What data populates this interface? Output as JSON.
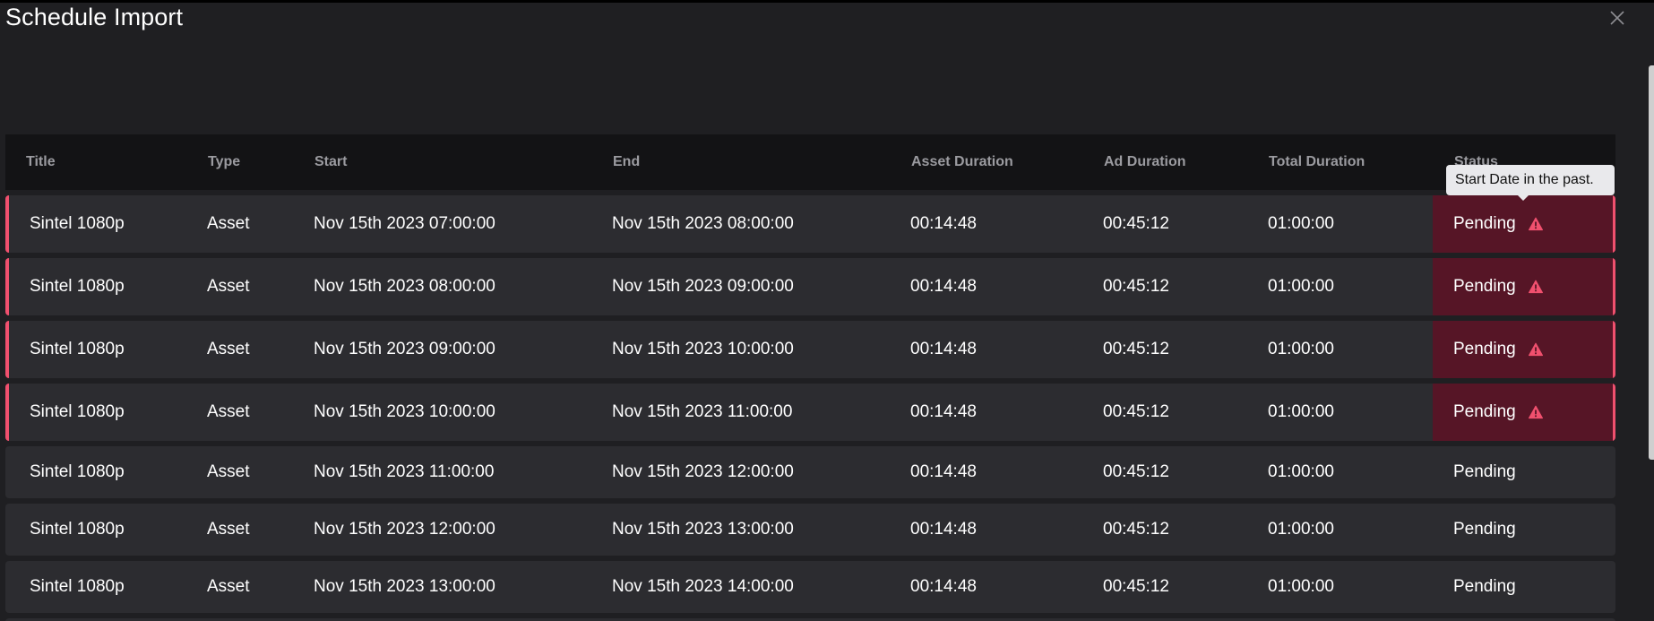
{
  "dialog": {
    "title": "Schedule Import"
  },
  "icons": {
    "close": "close-icon",
    "warning": "warning-triangle-icon"
  },
  "colors": {
    "background": "#1f1f22",
    "header_bg": "#131315",
    "row_bg": "#2c2c30",
    "warning_accent": "#f0506e",
    "warning_status_bg": "#561526",
    "tooltip_bg": "#e9e9ec"
  },
  "table": {
    "columns": [
      "Title",
      "Type",
      "Start",
      "End",
      "Asset Duration",
      "Ad Duration",
      "Total Duration",
      "Status"
    ],
    "rows": [
      {
        "title": "Sintel 1080p",
        "type": "Asset",
        "start": "Nov 15th 2023 07:00:00",
        "end": "Nov 15th 2023 08:00:00",
        "asset_duration": "00:14:48",
        "ad_duration": "00:45:12",
        "total_duration": "01:00:00",
        "status": "Pending",
        "warning": true
      },
      {
        "title": "Sintel 1080p",
        "type": "Asset",
        "start": "Nov 15th 2023 08:00:00",
        "end": "Nov 15th 2023 09:00:00",
        "asset_duration": "00:14:48",
        "ad_duration": "00:45:12",
        "total_duration": "01:00:00",
        "status": "Pending",
        "warning": true
      },
      {
        "title": "Sintel 1080p",
        "type": "Asset",
        "start": "Nov 15th 2023 09:00:00",
        "end": "Nov 15th 2023 10:00:00",
        "asset_duration": "00:14:48",
        "ad_duration": "00:45:12",
        "total_duration": "01:00:00",
        "status": "Pending",
        "warning": true
      },
      {
        "title": "Sintel 1080p",
        "type": "Asset",
        "start": "Nov 15th 2023 10:00:00",
        "end": "Nov 15th 2023 11:00:00",
        "asset_duration": "00:14:48",
        "ad_duration": "00:45:12",
        "total_duration": "01:00:00",
        "status": "Pending",
        "warning": true
      },
      {
        "title": "Sintel 1080p",
        "type": "Asset",
        "start": "Nov 15th 2023 11:00:00",
        "end": "Nov 15th 2023 12:00:00",
        "asset_duration": "00:14:48",
        "ad_duration": "00:45:12",
        "total_duration": "01:00:00",
        "status": "Pending",
        "warning": false
      },
      {
        "title": "Sintel 1080p",
        "type": "Asset",
        "start": "Nov 15th 2023 12:00:00",
        "end": "Nov 15th 2023 13:00:00",
        "asset_duration": "00:14:48",
        "ad_duration": "00:45:12",
        "total_duration": "01:00:00",
        "status": "Pending",
        "warning": false
      },
      {
        "title": "Sintel 1080p",
        "type": "Asset",
        "start": "Nov 15th 2023 13:00:00",
        "end": "Nov 15th 2023 14:00:00",
        "asset_duration": "00:14:48",
        "ad_duration": "00:45:12",
        "total_duration": "01:00:00",
        "status": "Pending",
        "warning": false
      }
    ]
  },
  "tooltip": {
    "text": "Start Date in the past."
  }
}
